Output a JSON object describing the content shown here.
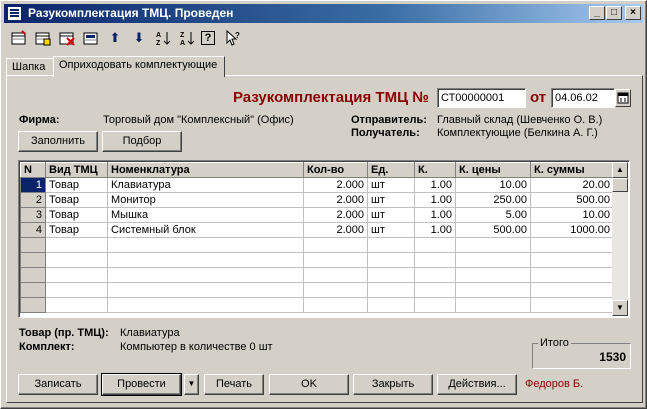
{
  "window": {
    "title": "Разукомплектация ТМЦ. Проведен",
    "controls": {
      "minimize": "_",
      "maximize": "□",
      "close": "×"
    }
  },
  "toolbar": {
    "icons": [
      "new-row-icon",
      "copy-row-icon",
      "delete-row-icon",
      "edit-row-icon",
      "move-up-icon",
      "move-down-icon",
      "sort-asc-icon",
      "sort-desc-icon",
      "help-icon",
      "context-help-icon"
    ],
    "move_up": "⬆",
    "move_down": "⬇",
    "help": "?",
    "context_help": "?"
  },
  "tabs": [
    {
      "label": "Шапка"
    },
    {
      "label": "Оприходовать комплектующие"
    }
  ],
  "header": {
    "doc_title": "Разукомплектация ТМЦ №",
    "doc_number": "СТ00000001",
    "date_label": "от",
    "doc_date": "04.06.02",
    "firm_label": "Фирма:",
    "firm_value": "Торговый дом \"Комплексный\" (Офис)",
    "sender_label": "Отправитель:",
    "sender_value": "Главный склад (Шевченко О. В.)",
    "receiver_label": "Получатель:",
    "receiver_value": "Комплектующие (Белкина А. Г.)",
    "fill_button": "Заполнить",
    "pick_button": "Подбор"
  },
  "table": {
    "columns": [
      "N",
      "Вид ТМЦ",
      "Номенклатура",
      "Кол-во",
      "Ед.",
      "К.",
      "К. цены",
      "К. суммы"
    ],
    "rows": [
      [
        "1",
        "Товар",
        "Клавиатура",
        "2.000",
        "шт",
        "1.00",
        "10.00",
        "20.00"
      ],
      [
        "2",
        "Товар",
        "Монитор",
        "2.000",
        "шт",
        "1.00",
        "250.00",
        "500.00"
      ],
      [
        "3",
        "Товар",
        "Мышка",
        "2.000",
        "шт",
        "1.00",
        "5.00",
        "10.00"
      ],
      [
        "4",
        "Товар",
        "Системный блок",
        "2.000",
        "шт",
        "1.00",
        "500.00",
        "1000.00"
      ]
    ],
    "selected_row": 1
  },
  "footer": {
    "item_label": "Товар (пр. ТМЦ):",
    "item_value": "Клавиатура",
    "kit_label": "Комплект:",
    "kit_value": "Компьютер в количестве 0 шт",
    "total_label": "Итого",
    "total_value": "1530"
  },
  "buttons": {
    "save": "Записать",
    "post": "Провести",
    "post_menu": "▼",
    "print": "Печать",
    "ok": "OK",
    "close": "Закрыть",
    "actions": "Действия...",
    "user": "Федоров Б."
  },
  "colors": {
    "title_accent": "#8b0000",
    "selection": "#0a246a"
  }
}
